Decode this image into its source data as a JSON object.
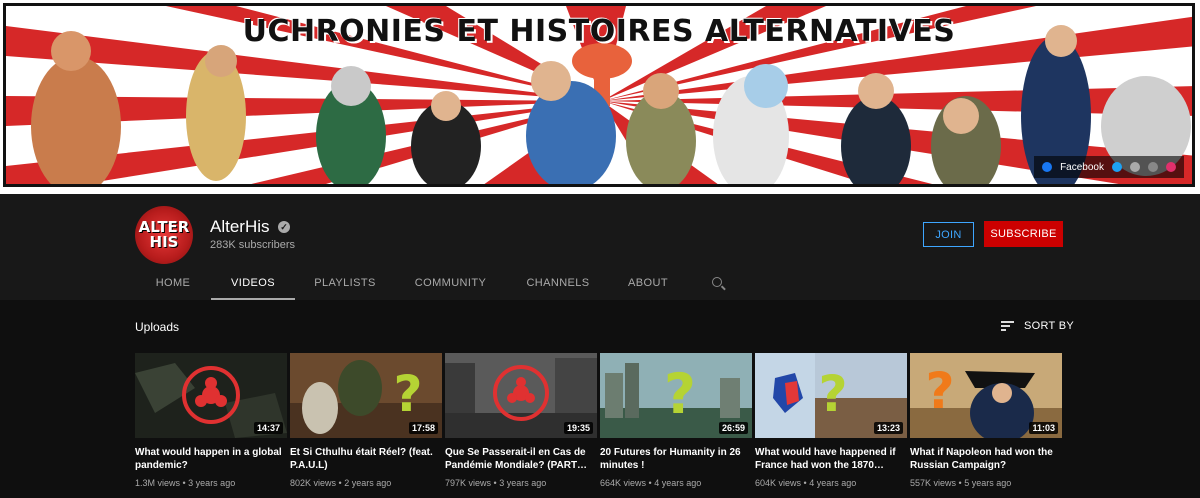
{
  "banner": {
    "title": "UCHRONIES ET HISTOIRES ALTERNATIVES",
    "social": {
      "facebook_label": "Facebook"
    }
  },
  "channel": {
    "avatar_line1": "ALTER",
    "avatar_line2": "HIS",
    "name": "AlterHis",
    "subscribers": "283K subscribers",
    "join_label": "JOIN",
    "subscribe_label": "SUBSCRIBE"
  },
  "tabs": [
    {
      "label": "HOME"
    },
    {
      "label": "VIDEOS"
    },
    {
      "label": "PLAYLISTS"
    },
    {
      "label": "COMMUNITY"
    },
    {
      "label": "CHANNELS"
    },
    {
      "label": "ABOUT"
    }
  ],
  "active_tab": "VIDEOS",
  "uploads": {
    "title": "Uploads",
    "sort_label": "SORT BY"
  },
  "videos": [
    {
      "title": "What would happen in a global pandemic?",
      "views": "1.3M views",
      "age": "3 years ago",
      "duration": "14:37",
      "thumb_icon": "biohazard-icon"
    },
    {
      "title": "Et Si Cthulhu était Réel? (feat. P.A.U.L)",
      "views": "802K views",
      "age": "2 years ago",
      "duration": "17:58",
      "thumb_icon": "question-mark-icon"
    },
    {
      "title": "Que Se Passerait-il en Cas de Pandémie Mondiale? (PART…",
      "views": "797K views",
      "age": "3 years ago",
      "duration": "19:35",
      "thumb_icon": "biohazard-icon"
    },
    {
      "title": "20 Futures for Humanity in 26 minutes !",
      "views": "664K views",
      "age": "4 years ago",
      "duration": "26:59",
      "thumb_icon": "question-mark-icon"
    },
    {
      "title": "What would have happened if France had won the 1870…",
      "views": "604K views",
      "age": "4 years ago",
      "duration": "13:23",
      "thumb_icon": "question-mark-icon"
    },
    {
      "title": "What if Napoleon had won the Russian Campaign?",
      "views": "557K views",
      "age": "5 years ago",
      "duration": "11:03",
      "thumb_icon": "question-mark-icon"
    }
  ],
  "colors": {
    "accent_red": "#cc0000",
    "join_blue": "#3ea6ff",
    "question_green": "#b5d334",
    "question_orange": "#f07a1a",
    "biohazard_red": "#e03131"
  }
}
